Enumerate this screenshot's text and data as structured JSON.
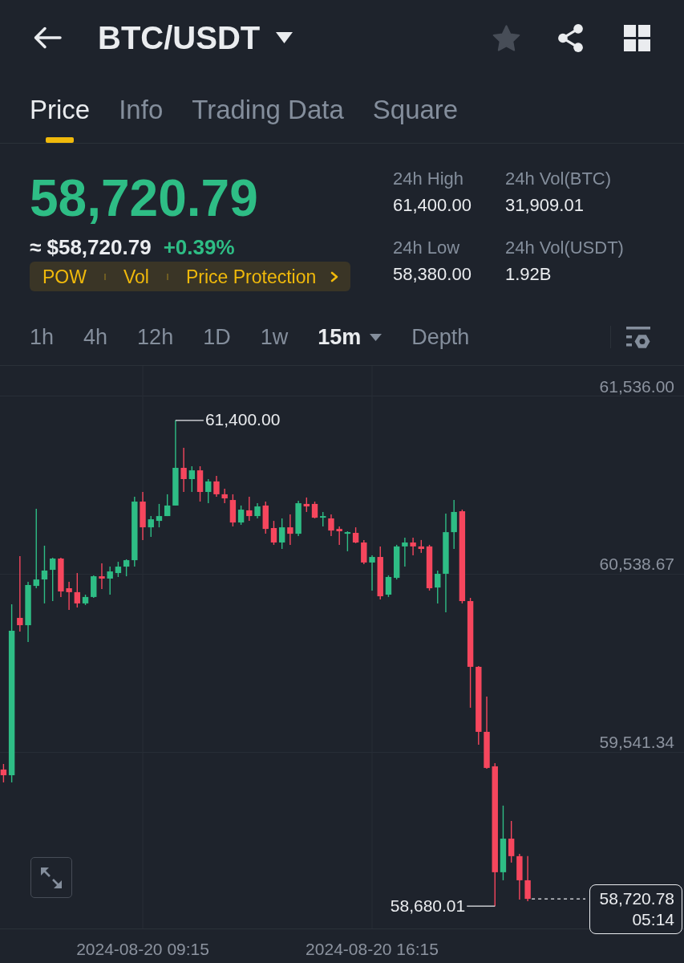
{
  "header": {
    "title": "BTC/USDT",
    "favorite": false
  },
  "tabs": [
    {
      "label": "Price",
      "selected": true
    },
    {
      "label": "Info",
      "selected": false
    },
    {
      "label": "Trading Data",
      "selected": false
    },
    {
      "label": "Square",
      "selected": false
    }
  ],
  "ticker": {
    "last_price": "58,720.79",
    "rising": true,
    "fiat_price": "≈ $58,720.79",
    "change": "+0.39%",
    "tags": [
      "POW",
      "Vol",
      "Price Protection"
    ]
  },
  "stats": [
    {
      "label": "24h High",
      "value": "61,400.00"
    },
    {
      "label": "24h Vol(BTC)",
      "value": "31,909.01"
    },
    {
      "label": "24h Low",
      "value": "58,380.00"
    },
    {
      "label": "24h Vol(USDT)",
      "value": "1.92B"
    }
  ],
  "intervals": [
    {
      "label": "1h",
      "selected": false,
      "menu": false
    },
    {
      "label": "4h",
      "selected": false,
      "menu": false
    },
    {
      "label": "12h",
      "selected": false,
      "menu": false
    },
    {
      "label": "1D",
      "selected": false,
      "menu": false
    },
    {
      "label": "1w",
      "selected": false,
      "menu": false
    },
    {
      "label": "15m",
      "selected": true,
      "menu": true
    },
    {
      "label": "Depth",
      "selected": false,
      "menu": false
    }
  ],
  "chart": {
    "chart_data": {
      "type": "candlestick",
      "categories": [
        null,
        null,
        null,
        null,
        null,
        null,
        null,
        null,
        null,
        null,
        null,
        null,
        null,
        null,
        null,
        null,
        null,
        "2024-08-20 09:15",
        null,
        null,
        null,
        null,
        null,
        null,
        null,
        null,
        null,
        null,
        null,
        null,
        null,
        null,
        null,
        null,
        null,
        null,
        null,
        null,
        null,
        null,
        null,
        null,
        null,
        null,
        null,
        "2024-08-20 16:15",
        null,
        null,
        null,
        null,
        null,
        null,
        null,
        null,
        null,
        null,
        null,
        null,
        null,
        null,
        null,
        null,
        null,
        null,
        null
      ],
      "ohlc": [
        [
          59445,
          59476,
          59373,
          59413
        ],
        [
          59413,
          60370,
          59373,
          60222
        ],
        [
          60294,
          60640,
          60217,
          60253
        ],
        [
          60253,
          60496,
          60159,
          60478
        ],
        [
          60473,
          60905,
          60460,
          60509
        ],
        [
          60509,
          60698,
          60375,
          60559
        ],
        [
          60563,
          60631,
          60388,
          60626
        ],
        [
          60626,
          60631,
          60411,
          60442
        ],
        [
          60460,
          60496,
          60339,
          60438
        ],
        [
          60438,
          60545,
          60352,
          60375
        ],
        [
          60375,
          60424,
          60366,
          60411
        ],
        [
          60411,
          60532,
          60406,
          60527
        ],
        [
          60527,
          60599,
          60456,
          60514
        ],
        [
          60514,
          60581,
          60424,
          60554
        ],
        [
          60545,
          60608,
          60523,
          60581
        ],
        [
          60581,
          60622,
          60527,
          60617
        ],
        [
          60617,
          60972,
          60581,
          60945
        ],
        [
          60945,
          60999,
          60730,
          60801
        ],
        [
          60801,
          60864,
          60748,
          60846
        ],
        [
          60837,
          60932,
          60801,
          60864
        ],
        [
          60864,
          60986,
          60864,
          60923
        ],
        [
          60923,
          61400,
          60923,
          61134
        ],
        [
          61134,
          61246,
          60999,
          61071
        ],
        [
          61071,
          61143,
          60999,
          61120
        ],
        [
          61120,
          61143,
          60945,
          60999
        ],
        [
          60999,
          61071,
          60936,
          61058
        ],
        [
          61058,
          61089,
          60972,
          60986
        ],
        [
          60986,
          61017,
          60936,
          60963
        ],
        [
          60954,
          60986,
          60806,
          60828
        ],
        [
          60828,
          60923,
          60815,
          60900
        ],
        [
          60896,
          60972,
          60837,
          60864
        ],
        [
          60864,
          60936,
          60851,
          60918
        ],
        [
          60923,
          60945,
          60765,
          60792
        ],
        [
          60797,
          60837,
          60703,
          60716
        ],
        [
          60716,
          60851,
          60680,
          60801
        ],
        [
          60801,
          60873,
          60703,
          60765
        ],
        [
          60765,
          60950,
          60752,
          60936
        ],
        [
          60932,
          60968,
          60887,
          60918
        ],
        [
          60932,
          60945,
          60851,
          60855
        ],
        [
          60855,
          60887,
          60806,
          60864
        ],
        [
          60851,
          60873,
          60752,
          60783
        ],
        [
          60792,
          60806,
          60703,
          60779
        ],
        [
          60765,
          60779,
          60667,
          60774
        ],
        [
          60770,
          60801,
          60712,
          60716
        ],
        [
          60716,
          60730,
          60595,
          60604
        ],
        [
          60604,
          60644,
          60447,
          60635
        ],
        [
          60635,
          60694,
          60397,
          60415
        ],
        [
          60424,
          60532,
          60411,
          60523
        ],
        [
          60518,
          60703,
          60509,
          60694
        ],
        [
          60694,
          60743,
          60581,
          60716
        ],
        [
          60716,
          60743,
          60644,
          60694
        ],
        [
          60694,
          60730,
          60658,
          60680
        ],
        [
          60694,
          60703,
          60447,
          60460
        ],
        [
          60464,
          60559,
          60375,
          60541
        ],
        [
          60541,
          60878,
          60325,
          60774
        ],
        [
          60774,
          60954,
          60680,
          60887
        ],
        [
          60891,
          60900,
          60375,
          60388
        ],
        [
          60388,
          60406,
          59791,
          60020
        ],
        [
          60020,
          60024,
          59584,
          59656
        ],
        [
          59656,
          59854,
          59449,
          59454
        ],
        [
          59463,
          59481,
          58680.01,
          58870
        ],
        [
          58870,
          59243,
          58825,
          59058
        ],
        [
          59058,
          59157,
          58924,
          58960
        ],
        [
          58960,
          58973,
          58717,
          58825
        ],
        [
          58825,
          58960,
          58708,
          58720.78
        ]
      ],
      "ylim": [
        58555,
        61709
      ],
      "yticks": [
        {
          "value": 59541.34,
          "label": "59,541.34"
        },
        {
          "value": 60538.67,
          "label": "60,538.67"
        },
        {
          "value": 61536,
          "label": "61,536.00"
        }
      ],
      "grid": true
    },
    "high_label": "61,400.00",
    "low_label": "58,680.01",
    "last_price": "58,720.78",
    "countdown": "05:14"
  }
}
